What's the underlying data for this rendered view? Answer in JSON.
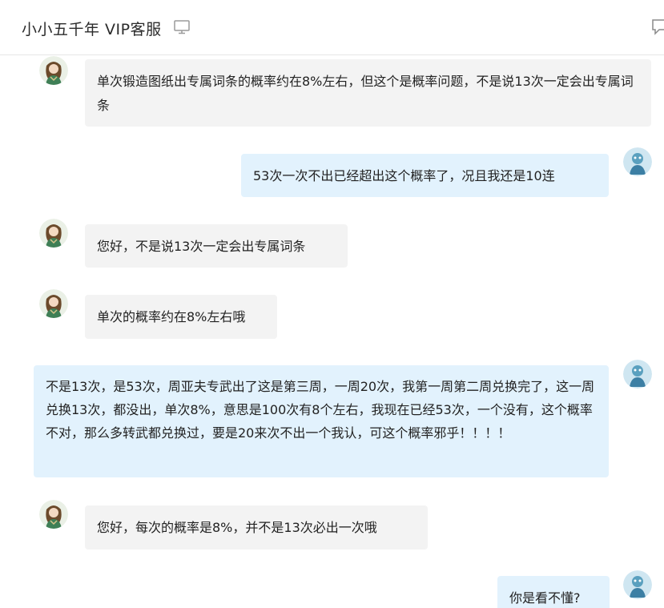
{
  "window": {
    "title": "小小五千年 VIP客服"
  },
  "icons": {
    "title_icon": "monitor-icon",
    "top_right_icon": "note-icon",
    "agent_avatar": "agent-avatar",
    "user_avatar": "user-avatar"
  },
  "colors": {
    "agent_bubble": "#f3f3f3",
    "user_bubble": "#e2f2fd"
  },
  "messages": [
    {
      "sender": "agent",
      "text": "单次锻造图纸出专属词条的概率约在8%左右，但这个是概率问题，不是说13次一定会出专属词条"
    },
    {
      "sender": "user",
      "text": "53次一次不出已经超出这个概率了，况且我还是10连"
    },
    {
      "sender": "agent",
      "text": "您好，不是说13次一定会出专属词条"
    },
    {
      "sender": "agent",
      "text": "单次的概率约在8%左右哦"
    },
    {
      "sender": "user",
      "text": "不是13次，是53次，周亚夫专武出了这是第三周，一周20次，我第一周第二周兑换完了，这一周兑换13次，都没出，单次8%，意思是100次有8个左右，我现在已经53次，一个没有，这个概率不对，那么多转武都兑换过，要是20来次不出一个我认，可这个概率邪乎！！！！"
    },
    {
      "sender": "agent",
      "text": "您好，每次的概率是8%，并不是13次必出一次哦"
    },
    {
      "sender": "user",
      "text": "你是看不懂?"
    }
  ]
}
